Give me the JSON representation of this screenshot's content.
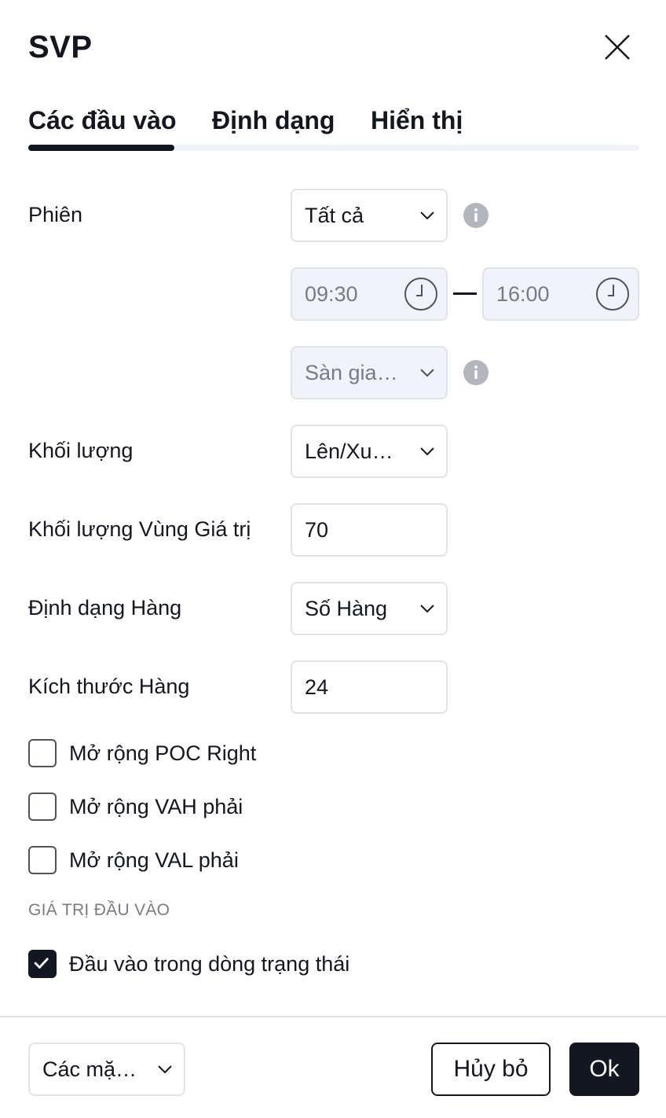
{
  "dialog": {
    "title": "SVP"
  },
  "tabs": [
    {
      "label": "Các đầu vào",
      "active": true
    },
    {
      "label": "Định dạng",
      "active": false
    },
    {
      "label": "Hiển thị",
      "active": false
    }
  ],
  "inputs": {
    "session": {
      "label": "Phiên",
      "value": "Tất cả"
    },
    "time_start": "09:30",
    "time_end": "16:00",
    "session_type": {
      "value": "Sàn gia…",
      "disabled": true
    },
    "volume": {
      "label": "Khối lượng",
      "value": "Lên/Xu…"
    },
    "value_area_volume": {
      "label": "Khối lượng Vùng Giá trị",
      "value": "70"
    },
    "row_format": {
      "label": "Định dạng Hàng",
      "value": "Số Hàng"
    },
    "row_size": {
      "label": "Kích thước Hàng",
      "value": "24"
    }
  },
  "checkboxes": [
    {
      "label": "Mở rộng POC Right",
      "checked": false
    },
    {
      "label": "Mở rộng VAH phải",
      "checked": false
    },
    {
      "label": "Mở rộng VAL phải",
      "checked": false
    }
  ],
  "input_values_section": {
    "heading": "GIÁ TRỊ ĐẦU VÀO",
    "checkbox": {
      "label": "Đầu vào trong dòng trạng thái",
      "checked": true
    }
  },
  "footer": {
    "defaults_label": "Các mặ…",
    "cancel_label": "Hủy bỏ",
    "ok_label": "Ok"
  },
  "colors": {
    "text": "#131722",
    "muted": "#787b86",
    "border": "#e0e3eb",
    "disabled_bg": "#f0f3fa",
    "primary": "#131722"
  },
  "icons": {
    "close": "close-icon",
    "chevron": "chevron-down-icon",
    "info": "info-icon",
    "clock": "clock-icon",
    "check": "check-icon"
  }
}
